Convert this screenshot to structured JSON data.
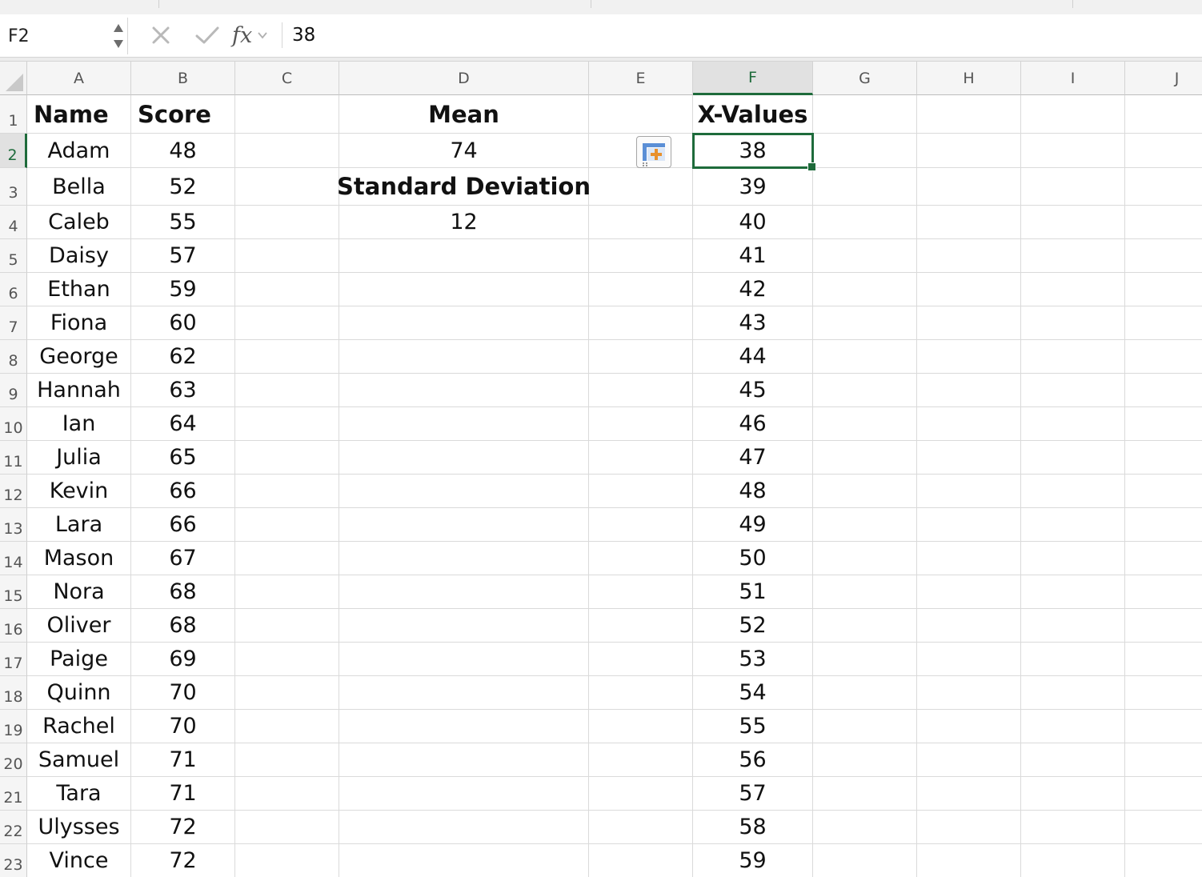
{
  "formula_bar": {
    "name_box": "F2",
    "formula_value": "38",
    "cancel_icon": "cancel-x-icon",
    "enter_icon": "checkmark-icon",
    "function_icon": "fx-icon",
    "function_label": "fx"
  },
  "columns": [
    {
      "label": "A"
    },
    {
      "label": "B"
    },
    {
      "label": "C"
    },
    {
      "label": "D"
    },
    {
      "label": "E"
    },
    {
      "label": "F"
    },
    {
      "label": "G"
    },
    {
      "label": "H"
    },
    {
      "label": "I"
    },
    {
      "label": "J"
    }
  ],
  "active_cell": {
    "column": "F",
    "row": 2
  },
  "rows": [
    {
      "num": "1",
      "A": "Name",
      "B": "Score",
      "D": "Mean",
      "F": "X-Values"
    },
    {
      "num": "2",
      "A": "Adam",
      "B": "48",
      "D": "74",
      "F": "38"
    },
    {
      "num": "3",
      "A": "Bella",
      "B": "52",
      "D": "Standard Deviation",
      "F": "39"
    },
    {
      "num": "4",
      "A": "Caleb",
      "B": "55",
      "D": "12",
      "F": "40"
    },
    {
      "num": "5",
      "A": "Daisy",
      "B": "57",
      "F": "41"
    },
    {
      "num": "6",
      "A": "Ethan",
      "B": "59",
      "F": "42"
    },
    {
      "num": "7",
      "A": "Fiona",
      "B": "60",
      "F": "43"
    },
    {
      "num": "8",
      "A": "George",
      "B": "62",
      "F": "44"
    },
    {
      "num": "9",
      "A": "Hannah",
      "B": "63",
      "F": "45"
    },
    {
      "num": "10",
      "A": "Ian",
      "B": "64",
      "F": "46"
    },
    {
      "num": "11",
      "A": "Julia",
      "B": "65",
      "F": "47"
    },
    {
      "num": "12",
      "A": "Kevin",
      "B": "66",
      "F": "48"
    },
    {
      "num": "13",
      "A": "Lara",
      "B": "66",
      "F": "49"
    },
    {
      "num": "14",
      "A": "Mason",
      "B": "67",
      "F": "50"
    },
    {
      "num": "15",
      "A": "Nora",
      "B": "68",
      "F": "51"
    },
    {
      "num": "16",
      "A": "Oliver",
      "B": "68",
      "F": "52"
    },
    {
      "num": "17",
      "A": "Paige",
      "B": "69",
      "F": "53"
    },
    {
      "num": "18",
      "A": "Quinn",
      "B": "70",
      "F": "54"
    },
    {
      "num": "19",
      "A": "Rachel",
      "B": "70",
      "F": "55"
    },
    {
      "num": "20",
      "A": "Samuel",
      "B": "71",
      "F": "56"
    },
    {
      "num": "21",
      "A": "Tara",
      "B": "71",
      "F": "57"
    },
    {
      "num": "22",
      "A": "Ulysses",
      "B": "72",
      "F": "58"
    },
    {
      "num": "23",
      "A": "Vince",
      "B": "72",
      "F": "59"
    }
  ],
  "quick_analysis_icon": "quick-analysis-icon",
  "colors": {
    "selection": "#1e6b3b",
    "header_bg": "#f5f5f5",
    "gridline": "#dadada",
    "quick_analysis_accent": "#e8912d"
  }
}
